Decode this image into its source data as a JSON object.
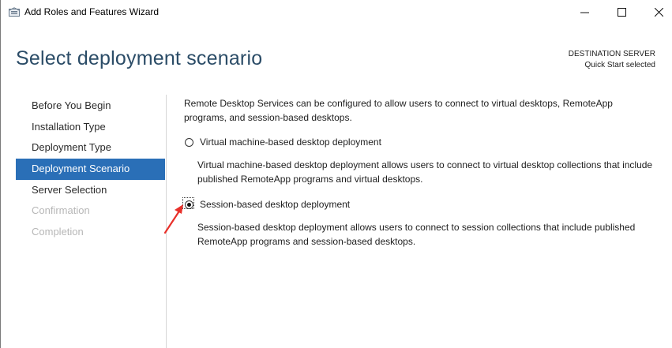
{
  "window": {
    "title": "Add Roles and Features Wizard"
  },
  "header": {
    "title": "Select deployment scenario",
    "destination_label": "DESTINATION SERVER",
    "destination_value": "Quick Start selected"
  },
  "nav": {
    "items": [
      {
        "label": "Before You Begin",
        "state": "normal"
      },
      {
        "label": "Installation Type",
        "state": "normal"
      },
      {
        "label": "Deployment Type",
        "state": "normal"
      },
      {
        "label": "Deployment Scenario",
        "state": "active"
      },
      {
        "label": "Server Selection",
        "state": "normal"
      },
      {
        "label": "Confirmation",
        "state": "disabled"
      },
      {
        "label": "Completion",
        "state": "disabled"
      }
    ]
  },
  "content": {
    "intro": "Remote Desktop Services can be configured to allow users to connect to virtual desktops, RemoteApp programs, and session-based desktops.",
    "options": [
      {
        "label": "Virtual machine-based desktop deployment",
        "description": "Virtual machine-based desktop deployment allows users to connect to virtual desktop collections that include published RemoteApp programs and virtual desktops.",
        "selected": false
      },
      {
        "label": "Session-based desktop deployment",
        "description": "Session-based desktop deployment allows users to connect to session collections that include published RemoteApp programs and session-based desktops.",
        "selected": true
      }
    ]
  },
  "colors": {
    "accent": "#2a6fb7",
    "title_color": "#2b4c67",
    "annotation_arrow": "#e8302a"
  },
  "icons": [
    "server-manager-icon",
    "minimize-icon",
    "maximize-icon",
    "close-icon",
    "annotation-arrow-icon"
  ]
}
